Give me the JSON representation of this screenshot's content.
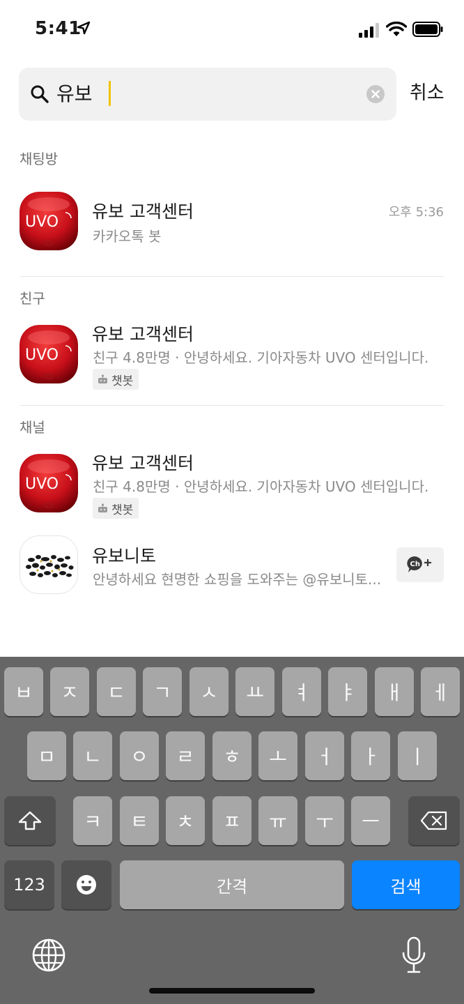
{
  "status_bar": {
    "time": "5:41"
  },
  "search": {
    "query": "유보",
    "cancel_label": "취소"
  },
  "sections": {
    "chatrooms": {
      "header": "채팅방",
      "items": [
        {
          "title": "유보 고객센터",
          "subtitle": "카카오톡 봇",
          "time": "오후 5:36",
          "logo_text": "UVO"
        }
      ]
    },
    "friends": {
      "header": "친구",
      "items": [
        {
          "title": "유보 고객센터",
          "subtitle": "친구 4.8만명 · 안녕하세요. 기아자동차 UVO 센터입니다.",
          "badge": "챗봇",
          "logo_text": "UVO"
        }
      ]
    },
    "channels": {
      "header": "채널",
      "items": [
        {
          "title": "유보 고객센터",
          "subtitle": "친구 4.8만명 · 안녕하세요. 기아자동차 UVO 센터입니다.",
          "badge": "챗봇",
          "logo_text": "UVO"
        },
        {
          "title": "유보니토",
          "subtitle": "안녕하세요 현명한 쇼핑을 도와주는 @유보니토...",
          "action_icon": "channel-add-icon"
        }
      ]
    }
  },
  "keyboard": {
    "row1": [
      "ㅂ",
      "ㅈ",
      "ㄷ",
      "ㄱ",
      "ㅅ",
      "ㅛ",
      "ㅕ",
      "ㅑ",
      "ㅐ",
      "ㅔ"
    ],
    "row2": [
      "ㅁ",
      "ㄴ",
      "ㅇ",
      "ㄹ",
      "ㅎ",
      "ㅗ",
      "ㅓ",
      "ㅏ",
      "ㅣ"
    ],
    "row3": [
      "ㅋ",
      "ㅌ",
      "ㅊ",
      "ㅍ",
      "ㅠ",
      "ㅜ",
      "ㅡ"
    ],
    "numbers_label": "123",
    "space_label": "간격",
    "search_label": "검색"
  },
  "colors": {
    "accent_blue": "#0a84ff",
    "caret": "#f2c300",
    "uvo_red": "#c8101a"
  }
}
